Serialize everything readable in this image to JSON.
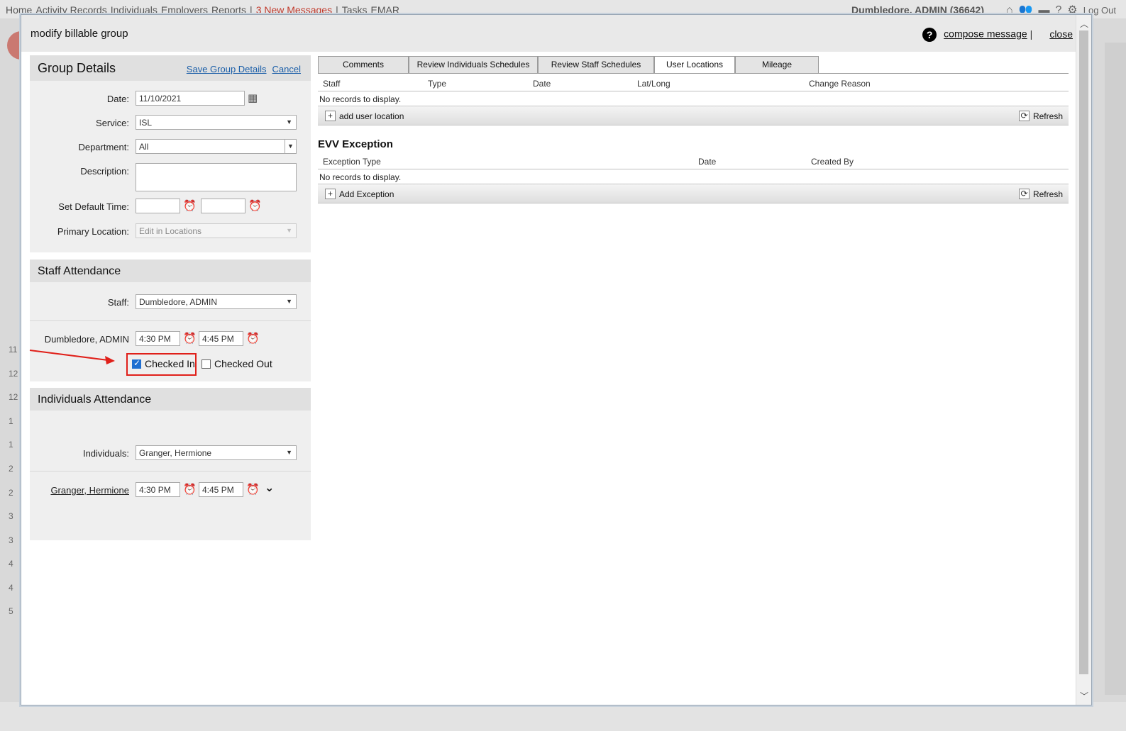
{
  "background_app": {
    "nav": [
      "Home",
      "Activity Records",
      "Individuals",
      "Employers",
      "Reports",
      "|",
      "3 New Messages",
      "|",
      "Tasks",
      "EMAR"
    ],
    "user": "Dumbledore, ADMIN (36642)",
    "logout": "Log Out",
    "icons": [
      "home-icon",
      "people-icon",
      "briefcase-icon",
      "help-icon",
      "gear-icon"
    ],
    "left_numbers": [
      "11",
      "12",
      "12",
      "1",
      "1",
      "2",
      "2",
      "3",
      "3",
      "4",
      "4",
      "5"
    ]
  },
  "modal": {
    "title": "modify billable group",
    "help_icon": "?",
    "compose_message": "compose message",
    "separator": "|",
    "close": "close"
  },
  "group_details": {
    "title": "Group Details",
    "save_label": "Save Group Details",
    "cancel_label": "Cancel",
    "date_label": "Date:",
    "date_value": "11/10/2021",
    "service_label": "Service:",
    "service_value": "ISL",
    "department_label": "Department:",
    "department_value": "All",
    "description_label": "Description:",
    "description_value": "",
    "default_time_label": "Set Default Time:",
    "default_time_start": "",
    "default_time_end": "",
    "primary_location_label": "Primary Location:",
    "primary_location_value": "Edit in Locations"
  },
  "staff_attendance": {
    "title": "Staff Attendance",
    "staff_label": "Staff:",
    "staff_value": "Dumbledore, ADMIN",
    "entries": [
      {
        "name": "Dumbledore, ADMIN",
        "start": "4:30 PM",
        "end": "4:45 PM",
        "checked_in_label": "Checked In",
        "checked_in": true,
        "checked_out_label": "Checked Out",
        "checked_out": false
      }
    ]
  },
  "individuals_attendance": {
    "title": "Individuals Attendance",
    "individuals_label": "Individuals:",
    "individuals_value": "Granger, Hermione",
    "entries": [
      {
        "name": "Granger, Hermione",
        "start": "4:30 PM",
        "end": "4:45 PM"
      }
    ]
  },
  "tabs": [
    {
      "label": "Comments",
      "active": false
    },
    {
      "label": "Review Individuals Schedules",
      "active": false
    },
    {
      "label": "Review Staff Schedules",
      "active": false
    },
    {
      "label": "User Locations",
      "active": true
    },
    {
      "label": "Mileage",
      "active": false
    }
  ],
  "user_locations_grid": {
    "columns": [
      "Staff",
      "Type",
      "Date",
      "Lat/Long",
      "Change Reason"
    ],
    "empty_text": "No records to display.",
    "add_label": "add user location",
    "refresh_label": "Refresh"
  },
  "evv_exception": {
    "title": "EVV Exception",
    "columns": [
      "Exception Type",
      "Date",
      "Created By"
    ],
    "empty_text": "No records to display.",
    "add_label": "Add Exception",
    "refresh_label": "Refresh"
  }
}
